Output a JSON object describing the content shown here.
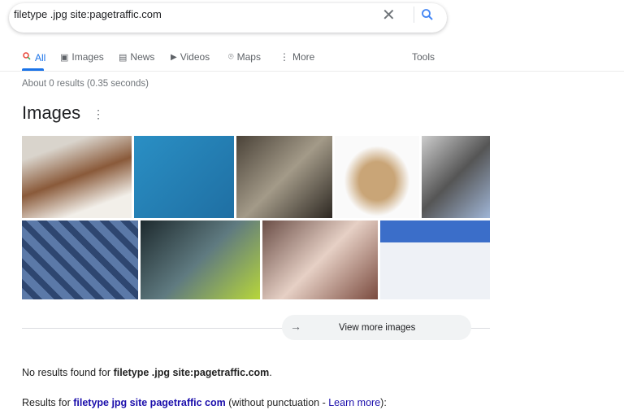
{
  "search": {
    "query": "filetype .jpg site:pagetraffic.com",
    "clear_icon": "close-icon",
    "search_icon": "search-icon"
  },
  "tabs": [
    {
      "label": "All",
      "icon": "search-icon",
      "active": true
    },
    {
      "label": "Images",
      "icon": "image-icon"
    },
    {
      "label": "News",
      "icon": "news-icon"
    },
    {
      "label": "Videos",
      "icon": "play-icon"
    },
    {
      "label": "Maps",
      "icon": "map-pin-icon"
    },
    {
      "label": "More",
      "icon": "more-vert-icon"
    }
  ],
  "tools_label": "Tools",
  "stats": "About 0 results (0.35 seconds)",
  "images": {
    "title": "Images",
    "view_more": "View more images"
  },
  "no_results": {
    "prefix": "No results found for ",
    "query": "filetype .jpg site:pagetraffic.com",
    "suffix": "."
  },
  "results_for": {
    "prefix": "Results for ",
    "query": "filetype jpg site pagetraffic com",
    "middle": " (without punctuation - ",
    "link": "Learn more",
    "suffix": "):"
  },
  "colors": {
    "accent": "#1a73e8",
    "link": "#1a0dab"
  }
}
